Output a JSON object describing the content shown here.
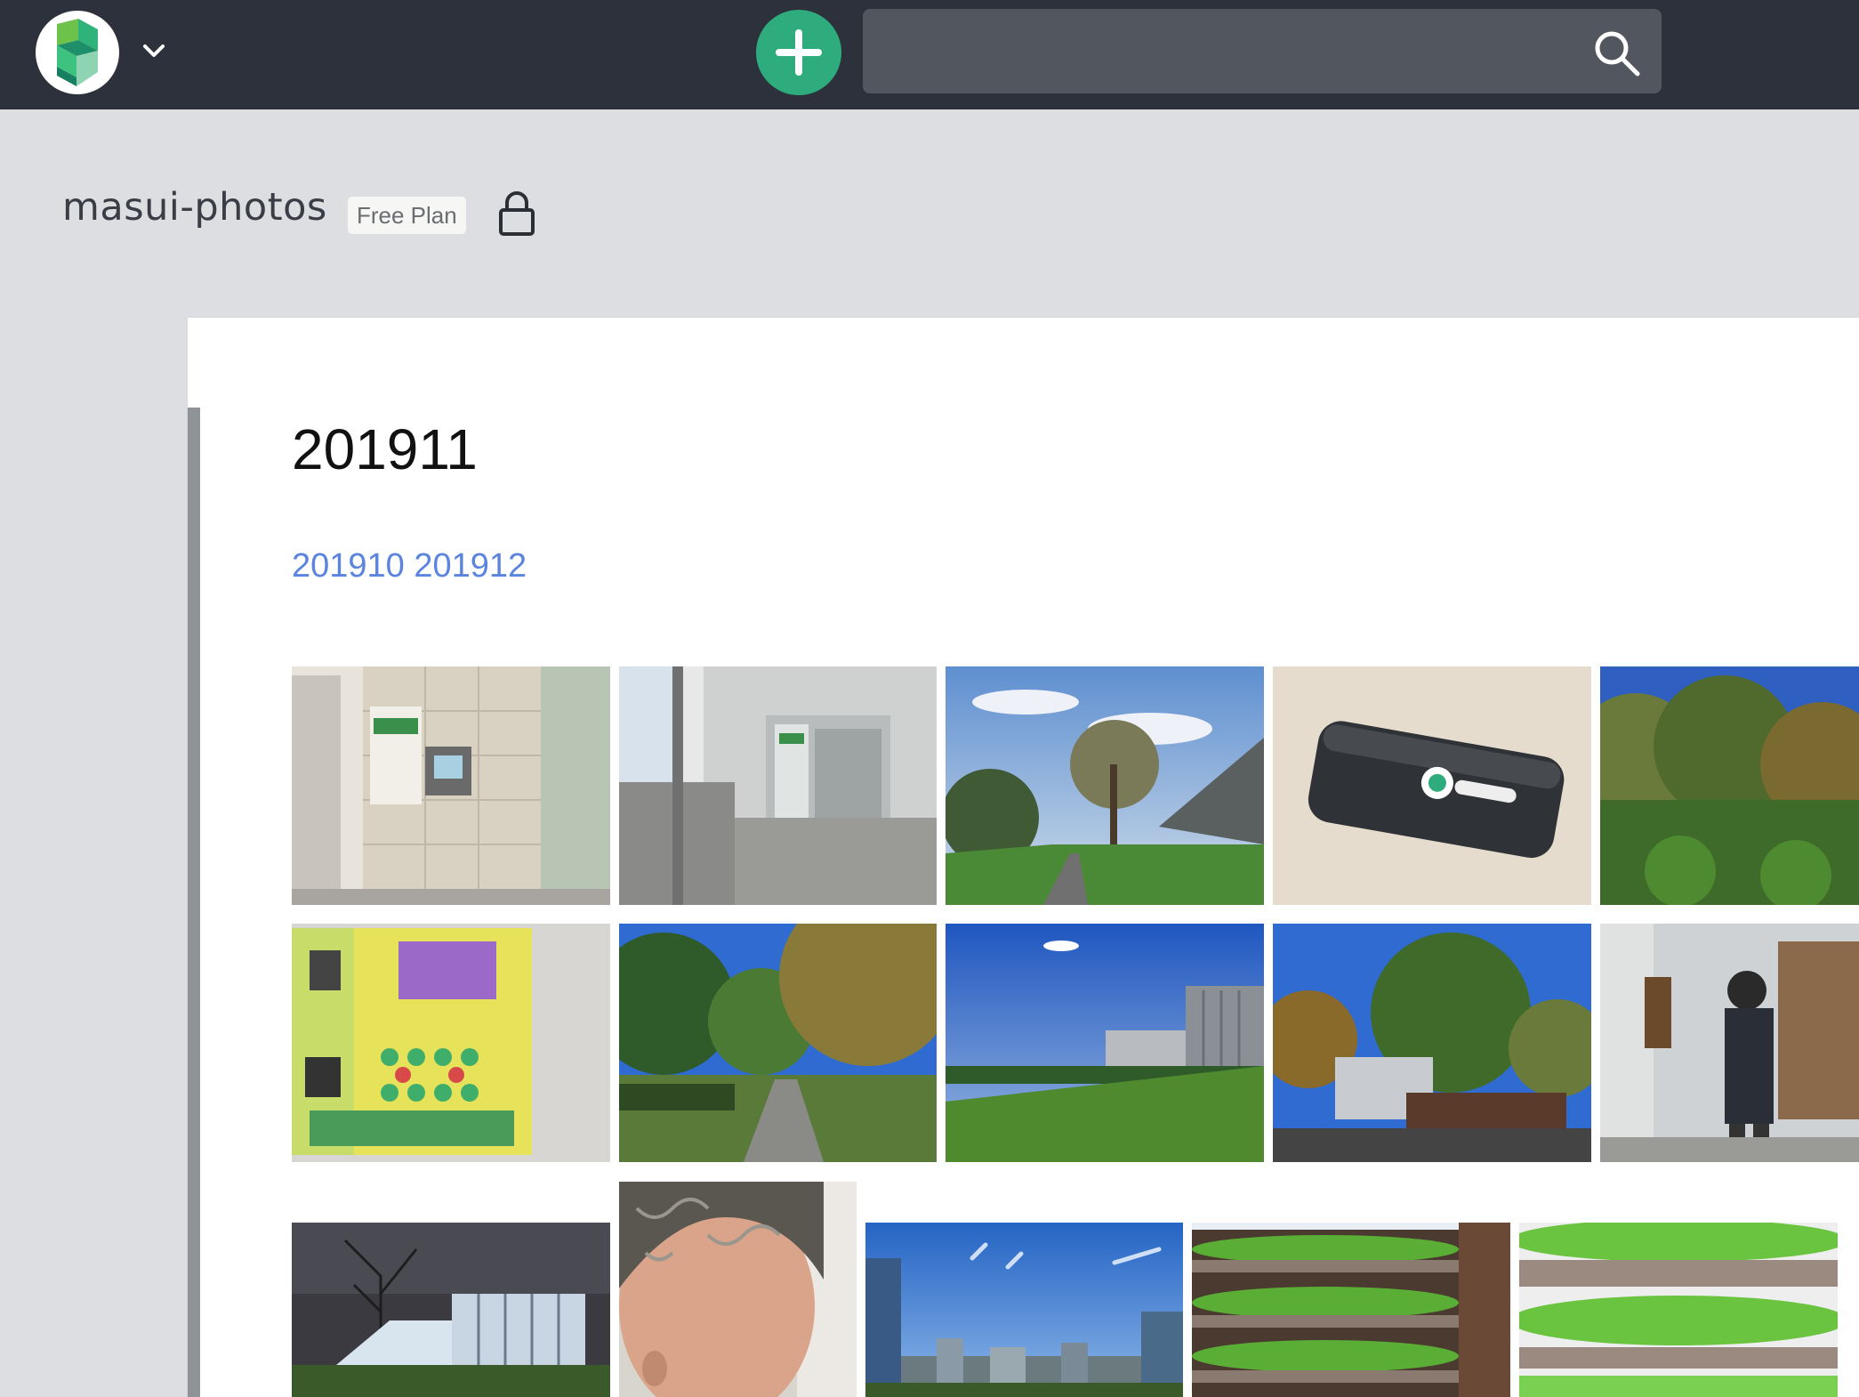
{
  "navbar": {
    "logo_icon": "scrapbox-logo-icon",
    "menu_icon": "chevron-down-icon",
    "add_icon": "plus-icon",
    "search_value": "",
    "search_icon": "search-icon",
    "colors": {
      "bar": "#2d313b",
      "add_button": "#2eac7e",
      "search_field": "#52565f"
    }
  },
  "project": {
    "name": "masui-photos",
    "plan": "Free Plan",
    "lock_icon": "lock-icon"
  },
  "page": {
    "title": "201911",
    "links": [
      "201910",
      "201912"
    ],
    "link_color": "#5a84de"
  },
  "photos": [
    {
      "subject": "parcel locker indoors"
    },
    {
      "subject": "parcel locker outdoors"
    },
    {
      "subject": "trees under blue sky"
    },
    {
      "subject": "black battery pack on table"
    },
    {
      "subject": "forest under blue sky"
    },
    {
      "subject": "event poster"
    },
    {
      "subject": "tree lined path"
    },
    {
      "subject": "lawn and building"
    },
    {
      "subject": "trees and building"
    },
    {
      "subject": "person with vr headset"
    },
    {
      "subject": "glass building at night"
    },
    {
      "subject": "man portrait"
    },
    {
      "subject": "city skyline"
    },
    {
      "subject": "indoor lettuce farm"
    },
    {
      "subject": "indoor lettuce farm close"
    }
  ]
}
